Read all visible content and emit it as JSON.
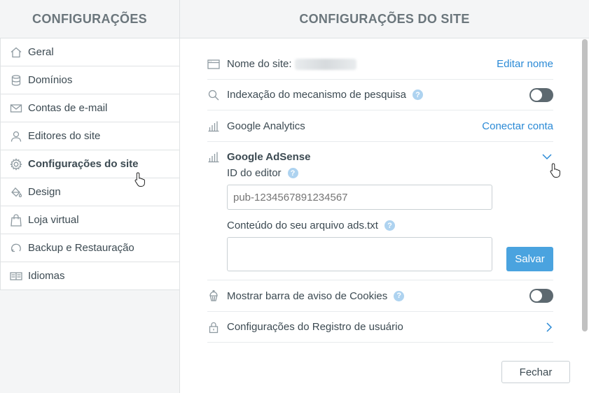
{
  "sidebar": {
    "title": "CONFIGURAÇÕES",
    "items": [
      {
        "label": "Geral",
        "icon": "home-icon"
      },
      {
        "label": "Domínios",
        "icon": "database-icon"
      },
      {
        "label": "Contas de e-mail",
        "icon": "mail-icon"
      },
      {
        "label": "Editores do site",
        "icon": "user-icon"
      },
      {
        "label": "Configurações do site",
        "icon": "gear-icon",
        "active": true
      },
      {
        "label": "Design",
        "icon": "paint-bucket-icon"
      },
      {
        "label": "Loja virtual",
        "icon": "shopping-bag-icon"
      },
      {
        "label": "Backup e Restauração",
        "icon": "restore-icon"
      },
      {
        "label": "Idiomas",
        "icon": "language-icon"
      }
    ]
  },
  "main": {
    "title": "CONFIGURAÇÕES DO SITE",
    "site_name": {
      "label": "Nome do site:",
      "action": "Editar nome"
    },
    "indexing": {
      "label": "Indexação do mecanismo de pesquisa",
      "help": "?",
      "enabled": false
    },
    "analytics": {
      "label": "Google Analytics",
      "action": "Conectar conta"
    },
    "adsense": {
      "label": "Google AdSense",
      "editor_id_label": "ID do editor",
      "editor_id_help": "?",
      "editor_id_placeholder": "pub-1234567891234567",
      "ads_txt_label": "Conteúdo do seu arquivo ads.txt",
      "ads_txt_help": "?",
      "save_label": "Salvar"
    },
    "cookies": {
      "label": "Mostrar barra de aviso de Cookies",
      "help": "?",
      "enabled": false
    },
    "user_registration": {
      "label": "Configurações do Registro de usuário"
    },
    "close_label": "Fechar"
  },
  "colors": {
    "accent": "#2b8ad6",
    "save_button": "#4aa3df",
    "toggle_off": "#5d6970"
  }
}
